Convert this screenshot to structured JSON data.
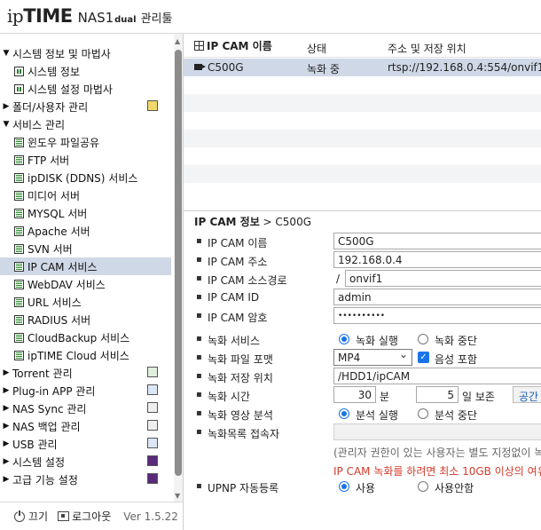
{
  "header": {
    "logo_ip": "ip",
    "logo_time": "TIME",
    "logo_nas": "NAS1",
    "logo_dual": "dual",
    "logo_mgr": "관리툴"
  },
  "sidebar": {
    "items": [
      {
        "label": "시스템 정보 및 마법사",
        "type": "group",
        "expanded": true
      },
      {
        "label": "시스템 정보",
        "type": "child"
      },
      {
        "label": "시스템 설정 마법사",
        "type": "child"
      },
      {
        "label": "폴더/사용자 관리",
        "type": "group",
        "expanded": false
      },
      {
        "label": "서비스 관리",
        "type": "group",
        "expanded": true
      },
      {
        "label": "윈도우 파일공유",
        "type": "child"
      },
      {
        "label": "FTP 서버",
        "type": "child"
      },
      {
        "label": "ipDISK (DDNS) 서비스",
        "type": "child"
      },
      {
        "label": "미디어 서버",
        "type": "child"
      },
      {
        "label": "MYSQL 서버",
        "type": "child"
      },
      {
        "label": "Apache 서버",
        "type": "child"
      },
      {
        "label": "SVN 서버",
        "type": "child"
      },
      {
        "label": "IP CAM 서비스",
        "type": "child",
        "selected": true
      },
      {
        "label": "WebDAV 서비스",
        "type": "child"
      },
      {
        "label": "URL 서비스",
        "type": "child"
      },
      {
        "label": "RADIUS 서버",
        "type": "child"
      },
      {
        "label": "CloudBackup 서비스",
        "type": "child"
      },
      {
        "label": "ipTIME Cloud 서비스",
        "type": "child"
      },
      {
        "label": "Torrent 관리",
        "type": "group",
        "expanded": false
      },
      {
        "label": "Plug-in APP 관리",
        "type": "group",
        "expanded": false
      },
      {
        "label": "NAS Sync 관리",
        "type": "group",
        "expanded": false
      },
      {
        "label": "NAS 백업 관리",
        "type": "group",
        "expanded": false
      },
      {
        "label": "USB 관리",
        "type": "group",
        "expanded": false
      },
      {
        "label": "시스템 설정",
        "type": "group",
        "expanded": false
      },
      {
        "label": "고급 기능 설정",
        "type": "group",
        "expanded": false
      }
    ]
  },
  "footer": {
    "power_label": "끄기",
    "logout_label": "로그아웃",
    "version": "Ver 1.5.22"
  },
  "cam_table": {
    "headers": {
      "name": "IP CAM 이름",
      "status": "상태",
      "address": "주소 및 저장 위치"
    },
    "rows": [
      {
        "name": "C500G",
        "status": "녹화 중",
        "address": "rtsp://192.168.0.4:554/onvif1"
      }
    ]
  },
  "detail": {
    "title_bold": "IP CAM 정보",
    "title_sep": " > ",
    "title_name": "C500G",
    "fields": {
      "name_label": "IP CAM 이름",
      "name_value": "C500G",
      "addr_label": "IP CAM 주소",
      "addr_value": "192.168.0.4",
      "path_label": "IP CAM 소스경로",
      "path_prefix": "/",
      "path_value": "onvif1",
      "id_label": "IP CAM ID",
      "id_value": "admin",
      "pw_label": "IP CAM 암호",
      "pw_value": "••••••••••",
      "rec_service_label": "녹화 서비스",
      "rec_on": "녹화 실행",
      "rec_off": "녹화 중단",
      "format_label": "녹화 파일 포맷",
      "format_value": "MP4",
      "audio_label": "음성 포함",
      "location_label": "녹화 저장 위치",
      "location_value": "/HDD1/ipCAM",
      "time_label": "녹화 시간",
      "time_minutes": "30",
      "time_min_unit": "분",
      "time_days": "5",
      "time_days_unit": "일 보존",
      "space_button": "공간",
      "analysis_label": "녹화 영상 분석",
      "analysis_on": "분석 실행",
      "analysis_off": "분석 중단",
      "viewer_label": "녹화목록 접속자",
      "note_gray": "(관리자 권한이 있는 사용자는 별도 지정없이 녹",
      "note_red": "IP CAM 녹화를 하려면 최소 10GB 이상의 여유",
      "upnp_label": "UPNP 자동등록",
      "upnp_on": "사용",
      "upnp_off": "사용안함"
    }
  }
}
